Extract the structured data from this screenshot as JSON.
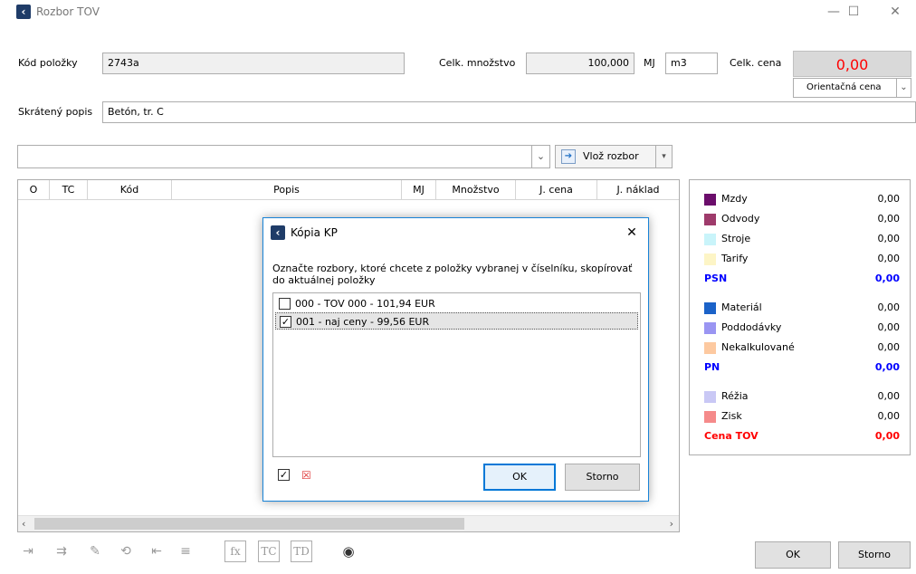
{
  "window": {
    "title": "Rozbor TOV",
    "minimize": "—",
    "maximize": "☐",
    "close": "✕"
  },
  "header": {
    "kod_label": "Kód položky",
    "kod_value": "2743a",
    "mnozstvo_label": "Celk. množstvo",
    "mnozstvo_value": "100,000",
    "mj_label": "MJ",
    "mj_value": "m3",
    "cena_label": "Celk. cena",
    "cena_value": "0,00",
    "cena_type": "Orientačná cena",
    "popis_label": "Skrátený popis",
    "popis_value": "Betón, tr. C"
  },
  "toolbar": {
    "insert_label": "Vlož rozbor"
  },
  "grid": {
    "columns": [
      "O",
      "TC",
      "Kód",
      "Popis",
      "MJ",
      "Množstvo",
      "J. cena",
      "J. náklad"
    ]
  },
  "summary": {
    "items": [
      {
        "name": "Mzdy",
        "value": "0,00",
        "color": "#6b0d6b"
      },
      {
        "name": "Odvody",
        "value": "0,00",
        "color": "#9e3b6b"
      },
      {
        "name": "Stroje",
        "value": "0,00",
        "color": "#c9f4fa"
      },
      {
        "name": "Tarify",
        "value": "0,00",
        "color": "#fdf5c6"
      },
      {
        "name": "PSN",
        "value": "0,00"
      },
      {
        "name": "Materiál",
        "value": "0,00",
        "color": "#1b62c8"
      },
      {
        "name": "Poddodávky",
        "value": "0,00",
        "color": "#9a95f2"
      },
      {
        "name": "Nekalkulované",
        "value": "0,00",
        "color": "#fdc9a0"
      },
      {
        "name": "PN",
        "value": "0,00"
      },
      {
        "name": "Réžia",
        "value": "0,00",
        "color": "#c9c8f5"
      },
      {
        "name": "Zisk",
        "value": "0,00",
        "color": "#f58a8a"
      },
      {
        "name": "Cena TOV",
        "value": "0,00"
      }
    ]
  },
  "dialog": {
    "title": "Kópia KP",
    "close": "✕",
    "message": "Označte rozbory, ktoré chcete z položky vybranej v číselníku, skopírovať do aktuálnej položky",
    "items": [
      {
        "label": "000 - TOV 000 - 101,94 EUR",
        "checked": false
      },
      {
        "label": "001 - naj ceny - 99,56 EUR",
        "checked": true
      }
    ],
    "ok": "OK",
    "cancel": "Storno"
  },
  "footer": {
    "fx": "fx",
    "tc": "TC",
    "td": "TD",
    "ok": "OK",
    "cancel": "Storno"
  },
  "colors": {
    "accent": "#0078d7",
    "price_red": "#ff0000"
  }
}
